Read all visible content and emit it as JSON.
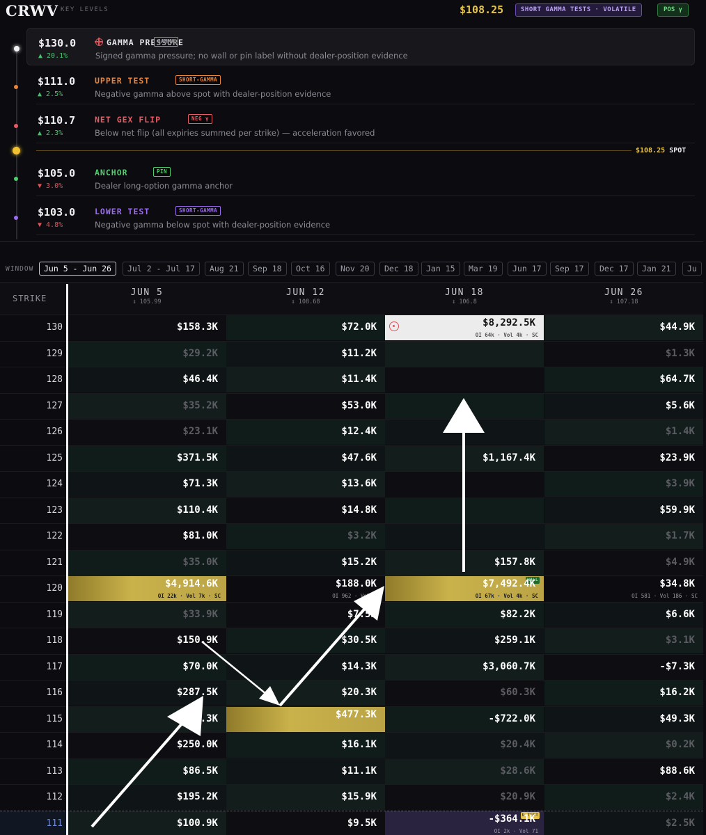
{
  "header": {
    "ticker": "CRWV",
    "subtitle": "KEY LEVELS",
    "spot_price": "$108.25",
    "regime_badge": "SHORT GAMMA TESTS · VOLATILE",
    "position_badge": "POS γ"
  },
  "levels": [
    {
      "price": "$130.0",
      "change": "▲ 20.1%",
      "direction": "up",
      "title": "GAMMA PRESSURE",
      "tag": "GAMMA",
      "description": "Signed gamma pressure; no wall or pin label without dealer-position evidence",
      "title_color": "#e6e6ea",
      "tag_color": "#9a9aa6",
      "dot_color": "#f2f2f4",
      "icon": "target-icon"
    },
    {
      "price": "$111.0",
      "change": "▲ 2.5%",
      "direction": "up",
      "title": "UPPER TEST",
      "tag": "SHORT-GAMMA",
      "description": "Negative gamma above spot with dealer-position evidence",
      "title_color": "#e8843c",
      "tag_color": "#e8843c",
      "dot_color": "#e8843c"
    },
    {
      "price": "$110.7",
      "change": "▲ 2.3%",
      "direction": "up",
      "title": "NET GEX FLIP",
      "tag": "NEG γ",
      "description": "Below net flip (all expiries summed per strike) — acceleration favored",
      "title_color": "#e85a64",
      "tag_color": "#e85a64",
      "dot_color": "#e85a64"
    },
    {
      "price": "$105.0",
      "change": "▼ 3.0%",
      "direction": "down",
      "title": "ANCHOR",
      "tag": "PIN",
      "description": "Dealer long-option gamma anchor",
      "title_color": "#4fcf6c",
      "tag_color": "#4fcf6c",
      "dot_color": "#4fcf6c"
    },
    {
      "price": "$103.0",
      "change": "▼ 4.8%",
      "direction": "down",
      "title": "LOWER TEST",
      "tag": "SHORT-GAMMA",
      "description": "Negative gamma below spot with dealer-position evidence",
      "title_color": "#9d6cf0",
      "tag_color": "#9d6cf0",
      "dot_color": "#9d6cf0"
    }
  ],
  "spot_marker": {
    "price": "$108.25",
    "label": "SPOT"
  },
  "window": {
    "label": "WINDOW",
    "options": [
      "Jun 5 - Jun 26",
      "Jul 2 - Jul 17",
      "Aug 21",
      "Sep 18",
      "Oct 16",
      "Nov 20",
      "Dec 18",
      "Jan 15",
      "Mar 19",
      "Jun 17",
      "Sep 17",
      "Dec 17",
      "Jan 21",
      "Ju"
    ],
    "selected": "Jun 5 - Jun 26"
  },
  "grid": {
    "strike_header": "STRIKE",
    "expiries": [
      {
        "date": "JUN 5",
        "sub": "↕ 105.99"
      },
      {
        "date": "JUN 12",
        "sub": "↕ 108.68"
      },
      {
        "date": "JUN 18",
        "sub": "↕ 106.8"
      },
      {
        "date": "JUN 26",
        "sub": "↕ 107.18"
      }
    ],
    "rows": [
      {
        "strike": "130",
        "cells": [
          {
            "v": "$158.3K"
          },
          {
            "v": "$72.0K"
          },
          {
            "v": "$8,292.5K",
            "style": "white",
            "meta": "OI 64k · Vol 4k · SC",
            "icon": true
          },
          {
            "v": "$44.9K"
          }
        ]
      },
      {
        "strike": "129",
        "cells": [
          {
            "v": "$29.2K",
            "dim": true
          },
          {
            "v": "$11.2K"
          },
          {
            "v": ""
          },
          {
            "v": "$1.3K",
            "dim": true
          }
        ]
      },
      {
        "strike": "128",
        "cells": [
          {
            "v": "$46.4K"
          },
          {
            "v": "$11.4K"
          },
          {
            "v": ""
          },
          {
            "v": "$64.7K"
          }
        ]
      },
      {
        "strike": "127",
        "cells": [
          {
            "v": "$35.2K",
            "dim": true
          },
          {
            "v": "$53.0K"
          },
          {
            "v": ""
          },
          {
            "v": "$5.6K"
          }
        ]
      },
      {
        "strike": "126",
        "cells": [
          {
            "v": "$23.1K",
            "dim": true
          },
          {
            "v": "$12.4K"
          },
          {
            "v": ""
          },
          {
            "v": "$1.4K",
            "dim": true
          }
        ]
      },
      {
        "strike": "125",
        "cells": [
          {
            "v": "$371.5K"
          },
          {
            "v": "$47.6K"
          },
          {
            "v": "$1,167.4K"
          },
          {
            "v": "$23.9K"
          }
        ]
      },
      {
        "strike": "124",
        "cells": [
          {
            "v": "$71.3K"
          },
          {
            "v": "$13.6K"
          },
          {
            "v": ""
          },
          {
            "v": "$3.9K",
            "dim": true
          }
        ]
      },
      {
        "strike": "123",
        "cells": [
          {
            "v": "$110.4K"
          },
          {
            "v": "$14.8K"
          },
          {
            "v": ""
          },
          {
            "v": "$59.9K"
          }
        ]
      },
      {
        "strike": "122",
        "cells": [
          {
            "v": "$81.0K"
          },
          {
            "v": "$3.2K",
            "dim": true
          },
          {
            "v": ""
          },
          {
            "v": "$1.7K",
            "dim": true
          }
        ]
      },
      {
        "strike": "121",
        "cells": [
          {
            "v": "$35.0K",
            "dim": true
          },
          {
            "v": "$15.2K"
          },
          {
            "v": "$157.8K"
          },
          {
            "v": "$4.9K",
            "dim": true
          }
        ]
      },
      {
        "strike": "120",
        "cells": [
          {
            "v": "$4,914.6K",
            "style": "gold",
            "meta": "OI 22k · Vol 7k · SC"
          },
          {
            "v": "$188.0K",
            "style": "plain-meta",
            "meta": "OI 962 · Vol 2k"
          },
          {
            "v": "$7,492.4K",
            "style": "gold",
            "meta": "OI 67k · Vol 4k · SC",
            "tag": "WALL"
          },
          {
            "v": "$34.8K",
            "style": "plain-meta",
            "meta": "OI 581 · Vol 186 · SC"
          }
        ]
      },
      {
        "strike": "119",
        "cells": [
          {
            "v": "$33.9K",
            "dim": true
          },
          {
            "v": "$7.5K"
          },
          {
            "v": "$82.2K"
          },
          {
            "v": "$6.6K"
          }
        ]
      },
      {
        "strike": "118",
        "cells": [
          {
            "v": "$150.9K"
          },
          {
            "v": "$30.5K"
          },
          {
            "v": "$259.1K"
          },
          {
            "v": "$3.1K",
            "dim": true
          }
        ]
      },
      {
        "strike": "117",
        "cells": [
          {
            "v": "$70.0K"
          },
          {
            "v": "$14.3K"
          },
          {
            "v": "$3,060.7K"
          },
          {
            "v": "-$7.3K"
          }
        ]
      },
      {
        "strike": "116",
        "cells": [
          {
            "v": "$287.5K"
          },
          {
            "v": "$20.3K"
          },
          {
            "v": "$60.3K",
            "dim": true
          },
          {
            "v": "$16.2K"
          }
        ]
      },
      {
        "strike": "115",
        "cells": [
          {
            "v": "$75.3K"
          },
          {
            "v": "$477.3K",
            "style": "gold"
          },
          {
            "v": "-$722.0K"
          },
          {
            "v": "$49.3K"
          }
        ]
      },
      {
        "strike": "114",
        "cells": [
          {
            "v": "$250.0K"
          },
          {
            "v": "$16.1K"
          },
          {
            "v": "$20.4K",
            "dim": true
          },
          {
            "v": "$0.2K",
            "dim": true
          }
        ]
      },
      {
        "strike": "113",
        "cells": [
          {
            "v": "$86.5K"
          },
          {
            "v": "$11.1K"
          },
          {
            "v": "$28.6K",
            "dim": true
          },
          {
            "v": "$88.6K"
          }
        ]
      },
      {
        "strike": "112",
        "cells": [
          {
            "v": "$195.2K"
          },
          {
            "v": "$15.9K"
          },
          {
            "v": "$20.9K",
            "dim": true
          },
          {
            "v": "$2.4K",
            "dim": true
          }
        ]
      },
      {
        "strike": "111",
        "cells": [
          {
            "v": "$100.9K"
          },
          {
            "v": "$9.5K"
          },
          {
            "v": "-$364.1K",
            "style": "purple",
            "meta": "OI 2k · Vol 71",
            "tag": "U-TEST"
          },
          {
            "v": "$2.5K",
            "dim": true
          }
        ]
      }
    ]
  },
  "colors": {
    "gold": "#c9b24a",
    "spot": "#e6c34a",
    "positive": "#48c26a",
    "negative": "#e0525a"
  }
}
